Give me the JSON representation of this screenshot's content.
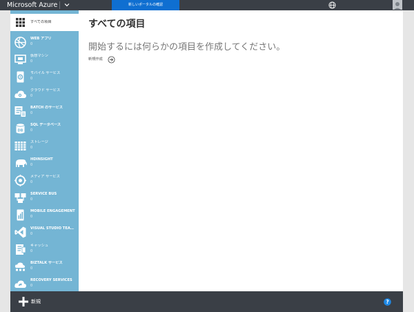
{
  "app": {
    "brand": "Microsoft Azure",
    "preview_banner": "新しいポータルの確認"
  },
  "colors": {
    "topbar": "#3a3f46",
    "sidebar": "#74b5d4",
    "banner": "#0f6fd1",
    "help": "#1e88e5"
  },
  "sidebar": {
    "items": [
      {
        "label": "すべての項目",
        "count": "",
        "icon": "grid-icon",
        "active": true
      },
      {
        "label": "WEB アプリ",
        "count": "0",
        "icon": "web-app-icon"
      },
      {
        "label": "仮想マシン",
        "count": "0",
        "icon": "virtual-machine-icon"
      },
      {
        "label": "モバイル サービス",
        "count": "0",
        "icon": "mobile-service-icon"
      },
      {
        "label": "クラウド サービス",
        "count": "0",
        "icon": "cloud-service-icon"
      },
      {
        "label": "BATCH のサービス",
        "count": "0",
        "icon": "batch-service-icon"
      },
      {
        "label": "SQL データベース",
        "count": "0",
        "icon": "sql-database-icon"
      },
      {
        "label": "ストレージ",
        "count": "0",
        "icon": "storage-icon"
      },
      {
        "label": "HDINSIGHT",
        "count": "0",
        "icon": "hdinsight-icon"
      },
      {
        "label": "メディア サービス",
        "count": "0",
        "icon": "media-service-icon"
      },
      {
        "label": "SERVICE BUS",
        "count": "0",
        "icon": "service-bus-icon"
      },
      {
        "label": "MOBILE ENGAGEMENT",
        "count": "0",
        "icon": "mobile-engagement-icon"
      },
      {
        "label": "VISUAL STUDIO TEAM SE...",
        "count": "0",
        "icon": "visual-studio-icon"
      },
      {
        "label": "キャッシュ",
        "count": "0",
        "icon": "cache-icon"
      },
      {
        "label": "BIZTALK サービス",
        "count": "0",
        "icon": "biztalk-icon"
      },
      {
        "label": "RECOVERY SERVICES",
        "count": "0",
        "icon": "recovery-services-icon"
      }
    ]
  },
  "main": {
    "title": "すべての項目",
    "headline": "開始するには何らかの項目を作成してください。",
    "create_link": "新規作成"
  },
  "bottombar": {
    "new_label": "新規"
  }
}
